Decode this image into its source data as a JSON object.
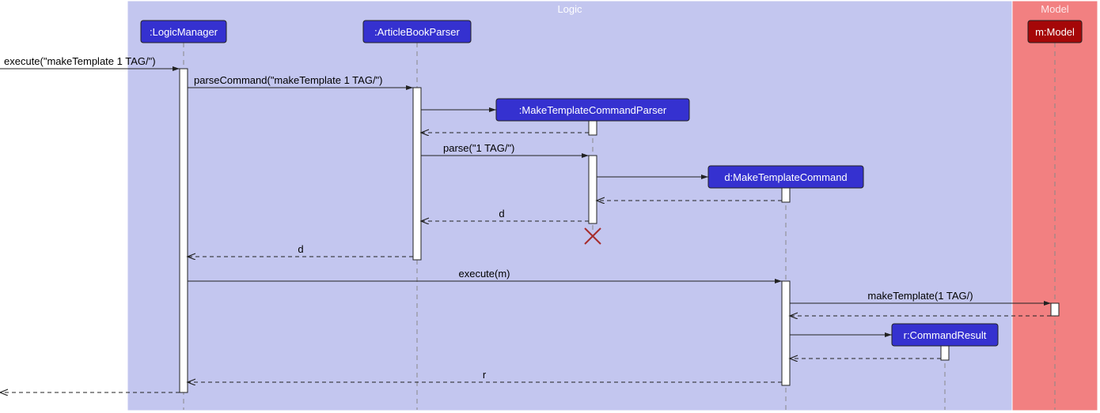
{
  "frames": {
    "logic": {
      "label": "Logic"
    },
    "model": {
      "label": "Model"
    }
  },
  "participants": {
    "logicManager": ":LogicManager",
    "articleBookParser": ":ArticleBookParser",
    "makeTemplateCommandParser": ":MakeTemplateCommandParser",
    "makeTemplateCommand": "d:MakeTemplateCommand",
    "commandResult": "r:CommandResult",
    "model": "m:Model"
  },
  "messages": {
    "m1": "execute(\"makeTemplate 1 TAG/\")",
    "m2": "parseCommand(\"makeTemplate 1 TAG/\")",
    "m3": "parse(\"1 TAG/\")",
    "m4": "d",
    "m5": "d",
    "m6": "execute(m)",
    "m7": "makeTemplate(1 TAG/)",
    "m8": "r"
  },
  "chart_data": {
    "type": "sequence-diagram",
    "frames": [
      {
        "name": "Logic",
        "contains": [
          ":LogicManager",
          ":ArticleBookParser",
          ":MakeTemplateCommandParser",
          "d:MakeTemplateCommand",
          "r:CommandResult"
        ]
      },
      {
        "name": "Model",
        "contains": [
          "m:Model"
        ]
      }
    ],
    "participants": [
      {
        "id": "actor",
        "name": "",
        "external": true
      },
      {
        "id": "lm",
        "name": ":LogicManager"
      },
      {
        "id": "abp",
        "name": ":ArticleBookParser"
      },
      {
        "id": "mtcp",
        "name": ":MakeTemplateCommandParser",
        "created_by": "abp"
      },
      {
        "id": "mtc",
        "name": "d:MakeTemplateCommand",
        "created_by": "mtcp"
      },
      {
        "id": "cr",
        "name": "r:CommandResult",
        "created_by": "mtc"
      },
      {
        "id": "model",
        "name": "m:Model"
      }
    ],
    "messages": [
      {
        "from": "actor",
        "to": "lm",
        "label": "execute(\"makeTemplate 1 TAG/\")",
        "type": "call"
      },
      {
        "from": "lm",
        "to": "abp",
        "label": "parseCommand(\"makeTemplate 1 TAG/\")",
        "type": "call"
      },
      {
        "from": "abp",
        "to": "mtcp",
        "label": "",
        "type": "create"
      },
      {
        "from": "mtcp",
        "to": "abp",
        "label": "",
        "type": "return"
      },
      {
        "from": "abp",
        "to": "mtcp",
        "label": "parse(\"1 TAG/\")",
        "type": "call"
      },
      {
        "from": "mtcp",
        "to": "mtc",
        "label": "",
        "type": "create"
      },
      {
        "from": "mtc",
        "to": "mtcp",
        "label": "",
        "type": "return"
      },
      {
        "from": "mtcp",
        "to": "abp",
        "label": "d",
        "type": "return"
      },
      {
        "from": "mtcp",
        "to": null,
        "label": "",
        "type": "destroy"
      },
      {
        "from": "abp",
        "to": "lm",
        "label": "d",
        "type": "return"
      },
      {
        "from": "lm",
        "to": "mtc",
        "label": "execute(m)",
        "type": "call"
      },
      {
        "from": "mtc",
        "to": "model",
        "label": "makeTemplate(1 TAG/)",
        "type": "call"
      },
      {
        "from": "model",
        "to": "mtc",
        "label": "",
        "type": "return"
      },
      {
        "from": "mtc",
        "to": "cr",
        "label": "",
        "type": "create"
      },
      {
        "from": "cr",
        "to": "mtc",
        "label": "",
        "type": "return"
      },
      {
        "from": "mtc",
        "to": "lm",
        "label": "r",
        "type": "return"
      },
      {
        "from": "lm",
        "to": "actor",
        "label": "",
        "type": "return"
      }
    ]
  }
}
